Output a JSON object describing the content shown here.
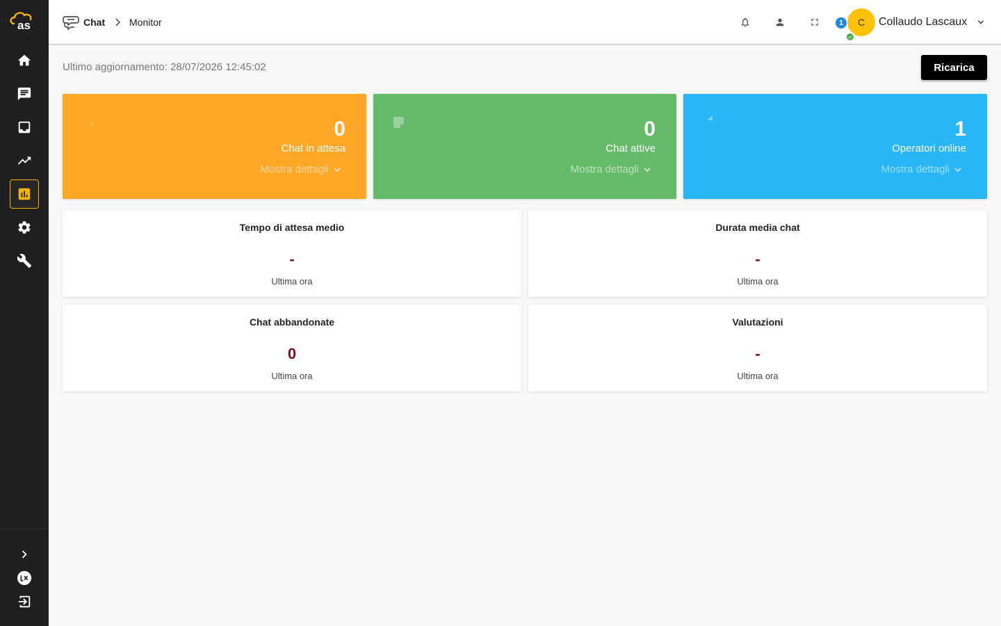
{
  "header": {
    "breadcrumb": {
      "section": "Chat",
      "page": "Monitor"
    },
    "operators_badge": "1",
    "user": {
      "initial": "C",
      "name": "Collaudo Lascaux",
      "status": "online"
    }
  },
  "sidebar": {
    "items": [
      {
        "icon": "home-icon"
      },
      {
        "icon": "chat-icon"
      },
      {
        "icon": "inbox-icon"
      },
      {
        "icon": "trending-icon"
      },
      {
        "icon": "bar-chart-icon",
        "active": true
      },
      {
        "icon": "gear-icon"
      },
      {
        "icon": "wrench-icon"
      }
    ],
    "bottom": [
      "expand-icon",
      "lx-logo-icon",
      "logout-icon"
    ]
  },
  "toolbar": {
    "last_update": "Ultimo aggiornamento: 28/07/2026 12:45:02",
    "reload_label": "Ricarica"
  },
  "stats": [
    {
      "value": "0",
      "label": "Chat in attesa",
      "more": "Mostra dettagli",
      "color": "#ffa726"
    },
    {
      "value": "0",
      "label": "Chat attive",
      "more": "Mostra dettagli",
      "color": "#66bb6a"
    },
    {
      "value": "1",
      "label": "Operatori online",
      "more": "Mostra dettagli",
      "color": "#29b6f6"
    }
  ],
  "metrics": [
    {
      "title": "Tempo di attesa medio",
      "value": "-",
      "sub": "Ultima ora"
    },
    {
      "title": "Durata media chat",
      "value": "-",
      "sub": "Ultima ora"
    },
    {
      "title": "Chat abbandonate",
      "value": "0",
      "sub": "Ultima ora"
    },
    {
      "title": "Valutazioni",
      "value": "-",
      "sub": "Ultima ora"
    }
  ],
  "colors": {
    "accent": "#f5b400",
    "sidebar": "#1f1f1f",
    "metric_value": "#7a0f1e"
  }
}
